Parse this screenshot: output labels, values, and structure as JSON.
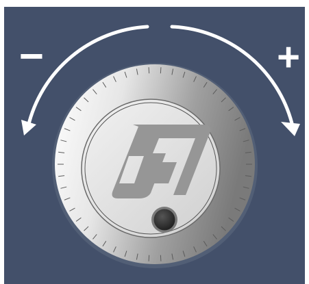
{
  "controls": {
    "decrease_label": "−",
    "increase_label": "+"
  },
  "colors": {
    "panel": "#43506a",
    "arrow": "#ffffff",
    "knob_light": "#f4f4f4",
    "knob_dark": "#8a8a8a",
    "logo": "#909090",
    "grip": "#2a2a2a"
  },
  "icons": {
    "dial": "handwheel-icon",
    "logo": "brand-logo-icon",
    "grip": "finger-grip-icon",
    "ccw": "counterclockwise-arrow-icon",
    "cw": "clockwise-arrow-icon"
  },
  "dial": {
    "tick_count": 50
  }
}
